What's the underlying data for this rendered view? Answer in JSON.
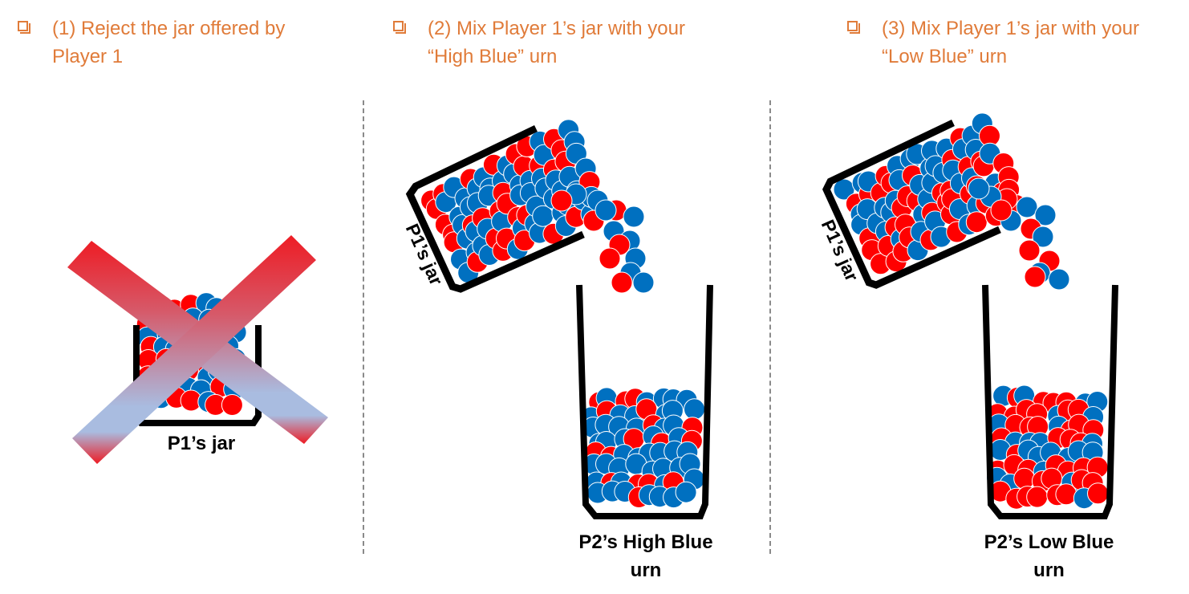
{
  "options": [
    {
      "text": "(1) Reject the jar offered by\nPlayer 1"
    },
    {
      "text": "(2) Mix Player 1’s jar with your\n“High Blue” urn"
    },
    {
      "text": "(3) Mix Player 1’s jar with your\n“Low Blue” urn"
    }
  ],
  "labels": {
    "p1_jar_1": "P1’s jar",
    "p1_jar_2": "P1’s jar",
    "p1_jar_3": "P1’s jar",
    "p2_high": "P2’s High Blue\nurn",
    "p2_low": "P2’s Low Blue\nurn"
  },
  "colors": {
    "accent": "#e07b39",
    "ball_red": "#ff0000",
    "ball_blue": "#0070c0",
    "cross_red": "#ee1c24",
    "cross_light": "#a9bce0"
  }
}
